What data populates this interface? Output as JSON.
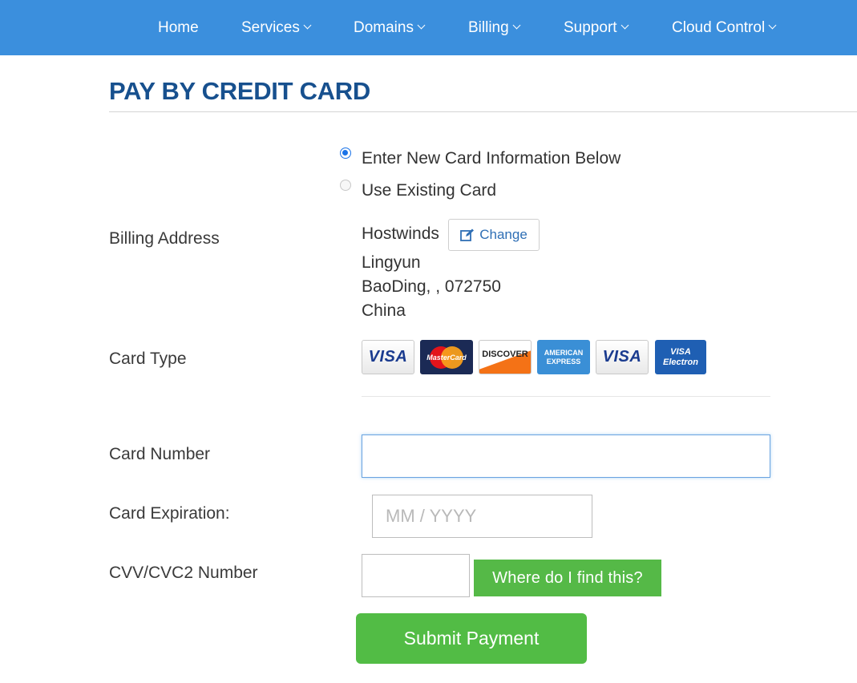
{
  "nav": {
    "items": [
      {
        "label": "Home",
        "has_dropdown": false
      },
      {
        "label": "Services",
        "has_dropdown": true
      },
      {
        "label": "Domains",
        "has_dropdown": true
      },
      {
        "label": "Billing",
        "has_dropdown": true
      },
      {
        "label": "Support",
        "has_dropdown": true
      },
      {
        "label": "Cloud Control",
        "has_dropdown": true
      }
    ],
    "bar_color": "#3b8fdd"
  },
  "page": {
    "title": "PAY BY CREDIT CARD",
    "title_color": "#17508e"
  },
  "card_choice": {
    "new_label": "Enter New Card Information Below",
    "existing_label": "Use Existing Card",
    "selected": "new"
  },
  "billing": {
    "label": "Billing Address",
    "name": "Hostwinds",
    "change_label": "Change",
    "line1": "Lingyun",
    "line2": "BaoDing, , 072750",
    "country": "China"
  },
  "card_type": {
    "label": "Card Type",
    "logos": [
      {
        "name": "visa-logo",
        "text": "VISA"
      },
      {
        "name": "mastercard-logo",
        "text": "MasterCard"
      },
      {
        "name": "discover-logo",
        "text": "DISCOVER"
      },
      {
        "name": "amex-logo",
        "text": "AMERICAN EXPRESS"
      },
      {
        "name": "visa-logo-2",
        "text": "VISA"
      },
      {
        "name": "visa-electron-logo",
        "text": "VISA Electron"
      }
    ]
  },
  "card_number": {
    "label": "Card Number",
    "value": ""
  },
  "expiration": {
    "label": "Card Expiration:",
    "placeholder": "MM / YYYY",
    "value": ""
  },
  "cvv": {
    "label": "CVV/CVC2 Number",
    "value": "",
    "help_label": "Where do I find this?"
  },
  "submit": {
    "label": "Submit Payment",
    "color": "#52bc45"
  }
}
